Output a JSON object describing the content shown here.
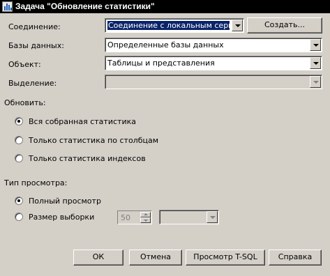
{
  "window": {
    "title": "Задача \"Обновление статистики\""
  },
  "connection": {
    "label": "Соединение:",
    "value": "Соединение с локальным сервером",
    "create_button": "Создать..."
  },
  "databases": {
    "label": "Базы данных:",
    "value": "Определенные базы данных"
  },
  "object": {
    "label": "Объект:",
    "value": "Таблицы и представления"
  },
  "selection": {
    "label": "Выделение:",
    "value": ""
  },
  "update": {
    "label": "Обновить:",
    "options": [
      {
        "label": "Вся собранная статистика",
        "checked": true
      },
      {
        "label": "Только статистика по столбцам",
        "checked": false
      },
      {
        "label": "Только статистика индексов",
        "checked": false
      }
    ]
  },
  "scan": {
    "label": "Тип просмотра:",
    "options": [
      {
        "label": "Полный просмотр",
        "checked": true
      },
      {
        "label": "Размер выборки",
        "checked": false
      }
    ],
    "sample_size": "50",
    "sample_unit": ""
  },
  "buttons": {
    "ok": "ОК",
    "cancel": "Отмена",
    "tsql": "Просмотр T-SQL",
    "help": "Справка"
  }
}
